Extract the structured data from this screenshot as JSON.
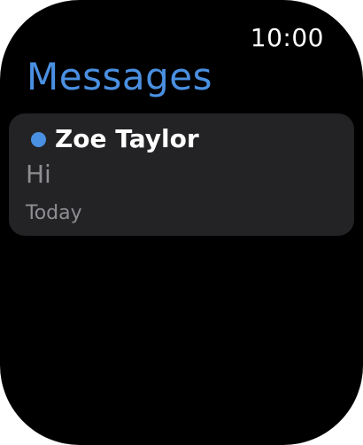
{
  "status_bar": {
    "time": "10:00"
  },
  "header": {
    "title": "Messages"
  },
  "conversations": [
    {
      "sender": "Zoe Taylor",
      "preview": "Hi",
      "date": "Today",
      "unread": true,
      "unread_icon": "unread-dot-icon"
    }
  ],
  "colors": {
    "accent": "#4a90e2",
    "background": "#000000",
    "card": "#232325",
    "primary_text": "#ffffff",
    "secondary_text": "#8e8e93",
    "unread_dot": "#4a90e2"
  }
}
